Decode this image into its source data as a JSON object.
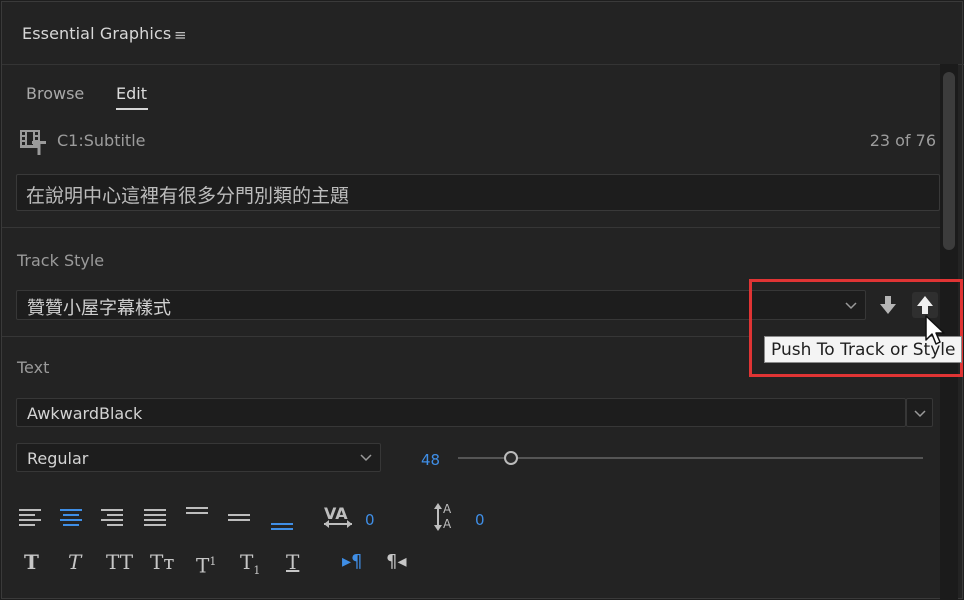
{
  "panel": {
    "title": "Essential Graphics",
    "menu_glyph": "≡"
  },
  "tabs": [
    {
      "label": "Browse",
      "active": false
    },
    {
      "label": "Edit",
      "active": true
    }
  ],
  "clip": {
    "name": "C1:Subtitle",
    "count": "23 of 76"
  },
  "subtitle_text": "在說明中心這裡有很多分門別類的主題",
  "track_style": {
    "label": "Track Style",
    "value": "贊贊小屋字幕樣式",
    "tooltip": "Push To Track or Style"
  },
  "text_section": {
    "label": "Text",
    "font": "AwkwardBlack",
    "weight": "Regular",
    "size": "48",
    "size_slider_fraction": 0.115,
    "kerning": "0",
    "leading": "0"
  },
  "icons": {
    "menu": "hamburger-menu-icon",
    "clip": "caption-clip-icon",
    "pull": "arrow-down-icon",
    "push": "arrow-up-icon"
  },
  "format_buttons": {
    "faux_bold": "T",
    "faux_italic": "T",
    "all_caps": "TT",
    "small_caps": "Tт",
    "superscript": "T",
    "superscript_mark": "1",
    "subscript": "T",
    "subscript_mark": "1",
    "underline": "T",
    "ltr_glyph": "▸¶",
    "rtl_glyph": "¶◂"
  },
  "colors": {
    "accent": "#3f8ee6",
    "highlight": "#e03434",
    "panel_bg": "#232323"
  }
}
